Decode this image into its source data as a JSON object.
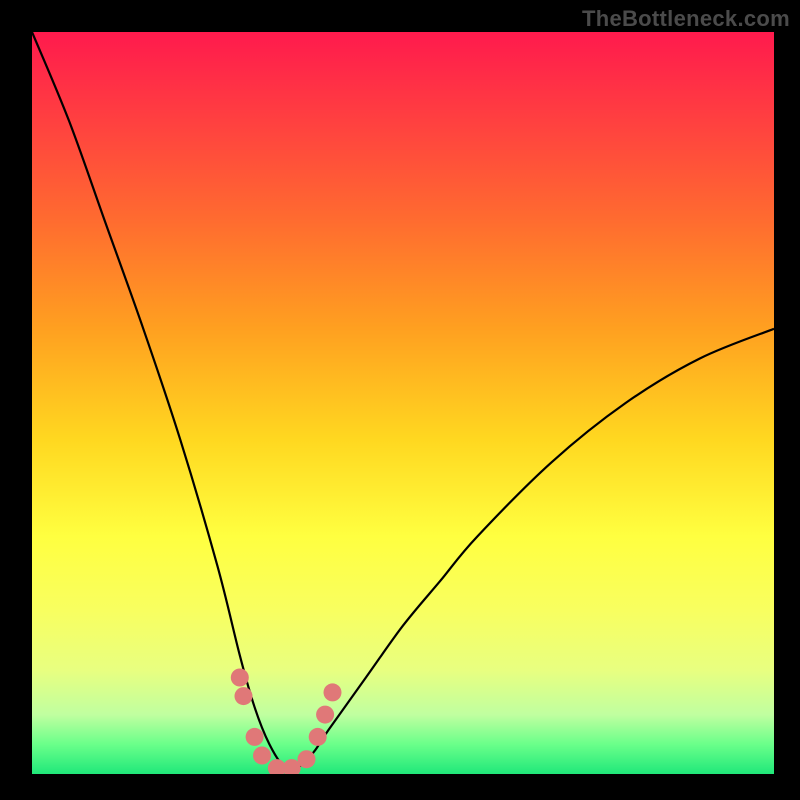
{
  "watermark": "TheBottleneck.com",
  "chart_data": {
    "type": "line",
    "title": "",
    "xlabel": "",
    "ylabel": "",
    "xlim": [
      0,
      100
    ],
    "ylim": [
      0,
      100
    ],
    "notes": "V-shaped bottleneck curve. y≈100 at x≈0, dips to y≈0 near x≈35, rises to y≈60 at x≈100. Background is a vertical heat gradient (red top → green bottom). Coral dots cluster along the curve near the trough.",
    "series": [
      {
        "name": "bottleneck-curve",
        "x": [
          0,
          5,
          10,
          15,
          20,
          25,
          28,
          30,
          32,
          34,
          36,
          38,
          40,
          45,
          50,
          55,
          60,
          70,
          80,
          90,
          100
        ],
        "y": [
          100,
          88,
          74,
          60,
          45,
          28,
          16,
          9,
          4,
          1,
          1,
          3,
          6,
          13,
          20,
          26,
          32,
          42,
          50,
          56,
          60
        ]
      }
    ],
    "scatter": {
      "name": "trough-dots",
      "x": [
        28.0,
        28.5,
        30.0,
        31.0,
        33.0,
        35.0,
        37.0,
        38.5,
        39.5,
        40.5
      ],
      "y": [
        13.0,
        10.5,
        5.0,
        2.5,
        0.8,
        0.8,
        2.0,
        5.0,
        8.0,
        11.0
      ]
    }
  }
}
